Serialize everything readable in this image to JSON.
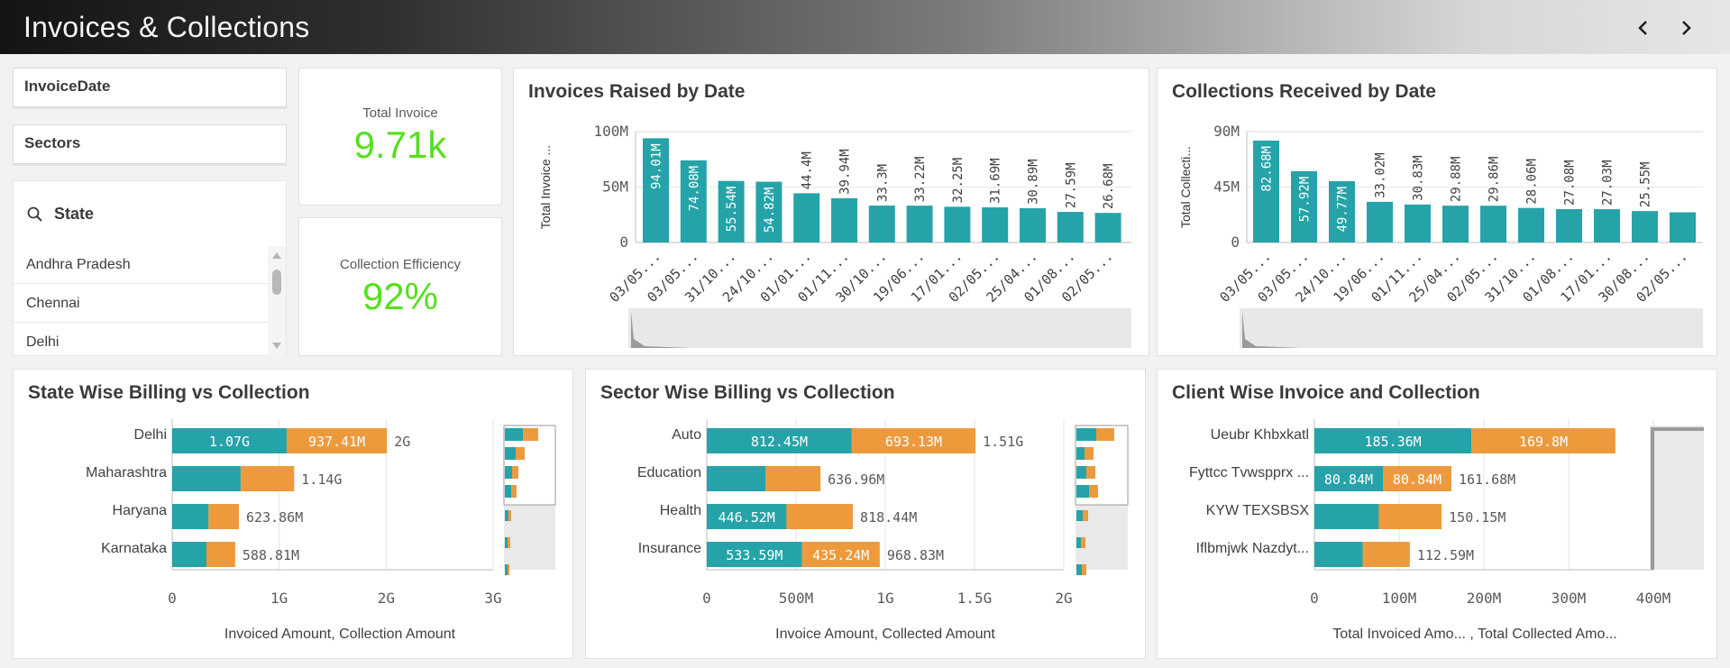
{
  "app": {
    "title": "Invoices & Collections"
  },
  "filters": {
    "invoice_date_label": "InvoiceDate",
    "sectors_label": "Sectors",
    "state_label": "State",
    "state_items": [
      "Andhra Pradesh",
      "Chennai",
      "Delhi"
    ]
  },
  "kpis": {
    "total_invoice_label": "Total Invoice",
    "total_invoice_value": "9.71k",
    "collection_efficiency_label": "Collection Efficiency",
    "collection_efficiency_value": "92%"
  },
  "colors": {
    "teal": "#26a3a8",
    "orange": "#ed9a3d",
    "kpi_green": "#56e01c"
  },
  "icons": [
    "chevron-left-icon",
    "chevron-right-icon",
    "search-icon"
  ],
  "chart_data": [
    {
      "type": "bar",
      "title": "Invoices Raised by Date",
      "ylabel": "Total Invoice ...",
      "categories": [
        "03/05...",
        "03/05...",
        "31/10...",
        "24/10...",
        "01/01...",
        "01/11...",
        "30/10...",
        "19/06...",
        "17/01...",
        "02/05...",
        "25/04...",
        "01/08...",
        "02/05..."
      ],
      "values": [
        94.01,
        74.08,
        55.54,
        54.82,
        44.4,
        39.94,
        33.3,
        33.22,
        32.25,
        31.69,
        30.89,
        27.59,
        26.68
      ],
      "value_labels": [
        "94.01M",
        "74.08M",
        "55.54M",
        "54.82M",
        "44.4M",
        "39.94M",
        "33.3M",
        "33.22M",
        "32.25M",
        "31.69M",
        "30.89M",
        "27.59M",
        "26.68M"
      ],
      "yticks": [
        "0",
        "50M",
        "100M"
      ],
      "ylim": [
        0,
        100
      ],
      "unit": "M"
    },
    {
      "type": "bar",
      "title": "Collections Received by Date",
      "ylabel": "Total Collecti...",
      "categories": [
        "03/05...",
        "03/05...",
        "24/10...",
        "19/06...",
        "01/11...",
        "25/04...",
        "02/05...",
        "31/10...",
        "01/08...",
        "17/01...",
        "30/08...",
        "02/05..."
      ],
      "values": [
        82.68,
        57.92,
        49.77,
        33.02,
        30.83,
        29.88,
        29.86,
        28.06,
        27.08,
        27.03,
        25.55,
        24.5
      ],
      "value_labels": [
        "82.68M",
        "57.92M",
        "49.77M",
        "33.02M",
        "30.83M",
        "29.88M",
        "29.86M",
        "28.06M",
        "27.08M",
        "27.03M",
        "25.55M",
        ""
      ],
      "yticks": [
        "0",
        "45M",
        "90M"
      ],
      "ylim": [
        0,
        90
      ],
      "unit": "M"
    },
    {
      "type": "bar",
      "orientation": "horizontal-stacked",
      "title": "State Wise Billing vs Collection",
      "xlabel": "Invoiced Amount, Collection Amount",
      "categories": [
        "Delhi",
        "Maharashtra",
        "Haryana",
        "Karnataka"
      ],
      "series": [
        {
          "name": "Invoiced Amount",
          "values": [
            1.07,
            0.64,
            0.34,
            0.32
          ],
          "labels": [
            "1.07G",
            "",
            "",
            ""
          ]
        },
        {
          "name": "Collection Amount",
          "values": [
            0.93741,
            0.5,
            0.28386,
            0.26881
          ],
          "labels": [
            "937.41M",
            "",
            "",
            ""
          ]
        }
      ],
      "totals": [
        "2G",
        "1.14G",
        "623.86M",
        "588.81M"
      ],
      "xticks": [
        "0",
        "1G",
        "2G",
        "3G"
      ],
      "xlim": [
        0,
        3
      ]
    },
    {
      "type": "bar",
      "orientation": "horizontal-stacked",
      "title": "Sector Wise Billing vs Collection",
      "xlabel": "Invoice Amount, Collected Amount",
      "categories": [
        "Auto",
        "Education",
        "Health",
        "Insurance"
      ],
      "series": [
        {
          "name": "Invoice Amount",
          "values": [
            0.81245,
            0.33,
            0.44652,
            0.53359
          ],
          "labels": [
            "812.45M",
            "",
            "446.52M",
            "533.59M"
          ]
        },
        {
          "name": "Collected Amount",
          "values": [
            0.69313,
            0.30696,
            0.37192,
            0.43524
          ],
          "labels": [
            "693.13M",
            "",
            "",
            "435.24M"
          ]
        }
      ],
      "totals": [
        "1.51G",
        "636.96M",
        "818.44M",
        "968.83M"
      ],
      "xticks": [
        "0",
        "500M",
        "1G",
        "1.5G",
        "2G"
      ],
      "xlim": [
        0,
        2
      ]
    },
    {
      "type": "bar",
      "orientation": "horizontal-stacked",
      "title": "Client Wise Invoice and Collection",
      "xlabel": "Total Invoiced Amo... , Total Collected Amo...",
      "categories": [
        "Ueubr Khbxkatl",
        "Fyttcc Tvwspprx ...",
        "KYW TEXSBSX",
        "Iflbmjwk Nazdyt..."
      ],
      "series": [
        {
          "name": "Total Invoiced Amo...",
          "values": [
            185.36,
            80.84,
            76,
            57
          ],
          "labels": [
            "185.36M",
            "80.84M",
            "",
            ""
          ]
        },
        {
          "name": "Total Collected Amo...",
          "values": [
            169.8,
            80.84,
            74.15,
            55.59
          ],
          "labels": [
            "169.8M",
            "80.84M",
            "",
            ""
          ]
        }
      ],
      "totals": [
        "",
        "161.68M",
        "150.15M",
        "112.59M"
      ],
      "xticks": [
        "0",
        "100M",
        "200M",
        "300M",
        "400M"
      ],
      "xlim": [
        0,
        400
      ]
    }
  ]
}
